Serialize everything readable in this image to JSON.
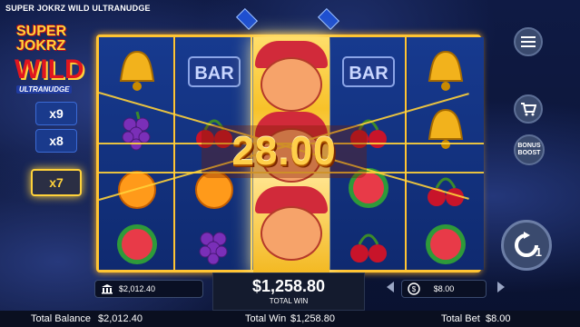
{
  "game_title": "SUPER JOKRZ WILD ULTRANUDGE",
  "logo": {
    "line1": "SUPER",
    "line2": "JOKRZ",
    "line3": "WILD",
    "line4": "ULTRANUDGE"
  },
  "multipliers": [
    "x9",
    "x8",
    "x7"
  ],
  "active_multiplier": "x7",
  "win_amount": "28.00",
  "reels": [
    [
      "bell",
      "grapes",
      "orange",
      "watermelon"
    ],
    [
      "bar",
      "cherries",
      "orange",
      "grapes"
    ],
    [
      "jester",
      "jester",
      "jester",
      "jester"
    ],
    [
      "bar",
      "cherries",
      "watermelon",
      "cherries"
    ],
    [
      "bell",
      "bell",
      "cherries",
      "watermelon"
    ]
  ],
  "side_buttons": {
    "bonus_label": "BONUS BOOST",
    "spin_count": "1"
  },
  "balance_box": "$2,012.40",
  "bet_box": "$8.00",
  "total_win_panel": {
    "value": "$1,258.80",
    "label": "TOTAL WIN"
  },
  "status_bar": {
    "balance_label": "Total Balance",
    "balance_value": "$2,012.40",
    "win_label": "Total Win",
    "win_value": "$1,258.80",
    "bet_label": "Total Bet",
    "bet_value": "$8.00"
  },
  "colors": {
    "accent": "#ffc433",
    "reel_bg": "#132e7a",
    "win_text": "#ffcf4a"
  }
}
